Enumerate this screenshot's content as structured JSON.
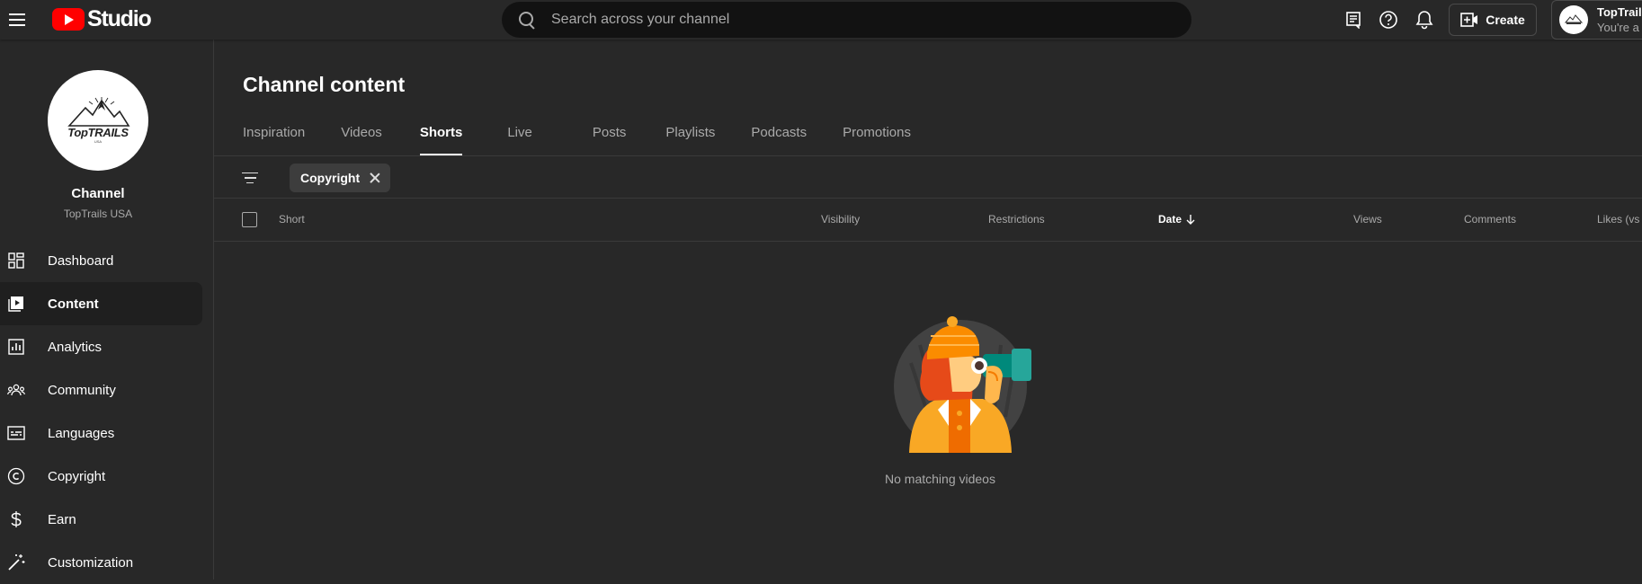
{
  "header": {
    "logo_text": "Studio",
    "search_placeholder": "Search across your channel",
    "create_label": "Create",
    "account_name": "TopTrails",
    "account_sub": "You're a m"
  },
  "sidebar": {
    "channel_avatar_text_top": "Top",
    "channel_avatar_text_bottom": "TRAILS",
    "channel_avatar_text_small": "USA",
    "channel_title": "Channel",
    "channel_name": "TopTrails USA",
    "items": [
      {
        "label": "Dashboard",
        "icon": "dashboard-icon"
      },
      {
        "label": "Content",
        "icon": "content-icon",
        "active": true
      },
      {
        "label": "Analytics",
        "icon": "analytics-icon"
      },
      {
        "label": "Community",
        "icon": "community-icon"
      },
      {
        "label": "Languages",
        "icon": "subtitles-icon"
      },
      {
        "label": "Copyright",
        "icon": "copyright-icon"
      },
      {
        "label": "Earn",
        "icon": "dollar-icon"
      },
      {
        "label": "Customization",
        "icon": "magic-wand-icon"
      }
    ]
  },
  "main": {
    "title": "Channel content",
    "tabs": [
      {
        "label": "Inspiration"
      },
      {
        "label": "Videos"
      },
      {
        "label": "Shorts",
        "active": true
      },
      {
        "label": "Live"
      },
      {
        "label": "Posts"
      },
      {
        "label": "Playlists"
      },
      {
        "label": "Podcasts"
      },
      {
        "label": "Promotions"
      }
    ],
    "filter_chip": "Copyright",
    "columns": {
      "short": "Short",
      "visibility": "Visibility",
      "restrictions": "Restrictions",
      "date": "Date",
      "views": "Views",
      "comments": "Comments",
      "likes": "Likes (vs"
    },
    "empty_message": "No matching videos"
  },
  "colors": {
    "background": "#282828",
    "brand_red": "#ff0000",
    "illustration_orange": "#f57c00",
    "illustration_teal": "#00897b"
  }
}
